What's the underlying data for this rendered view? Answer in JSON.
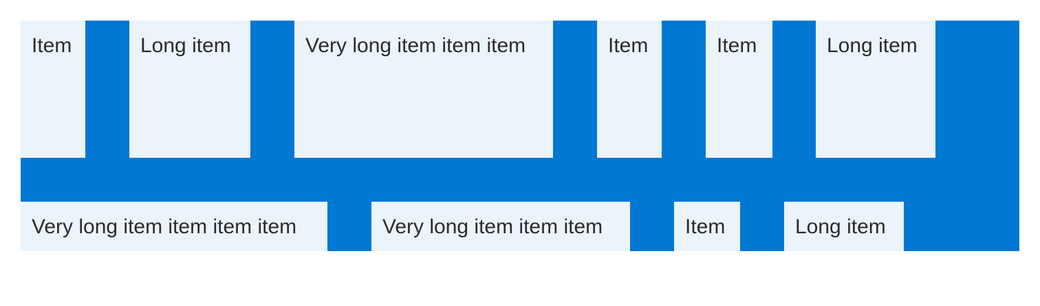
{
  "colors": {
    "container_background": "#0078d4",
    "item_background": "#ebf3fb",
    "item_text": "#2b2b2b",
    "page_background": "#ffffff"
  },
  "flex_container": {
    "rows": [
      {
        "items": [
          {
            "label": "Item"
          },
          {
            "label": "Long item"
          },
          {
            "label": "Very long item item item"
          },
          {
            "label": "Item"
          },
          {
            "label": "Item"
          },
          {
            "label": "Long item"
          }
        ]
      },
      {
        "items": [
          {
            "label": "Very long item item item item"
          },
          {
            "label": "Very long item item item"
          },
          {
            "label": "Item"
          },
          {
            "label": "Long item"
          }
        ]
      }
    ]
  }
}
